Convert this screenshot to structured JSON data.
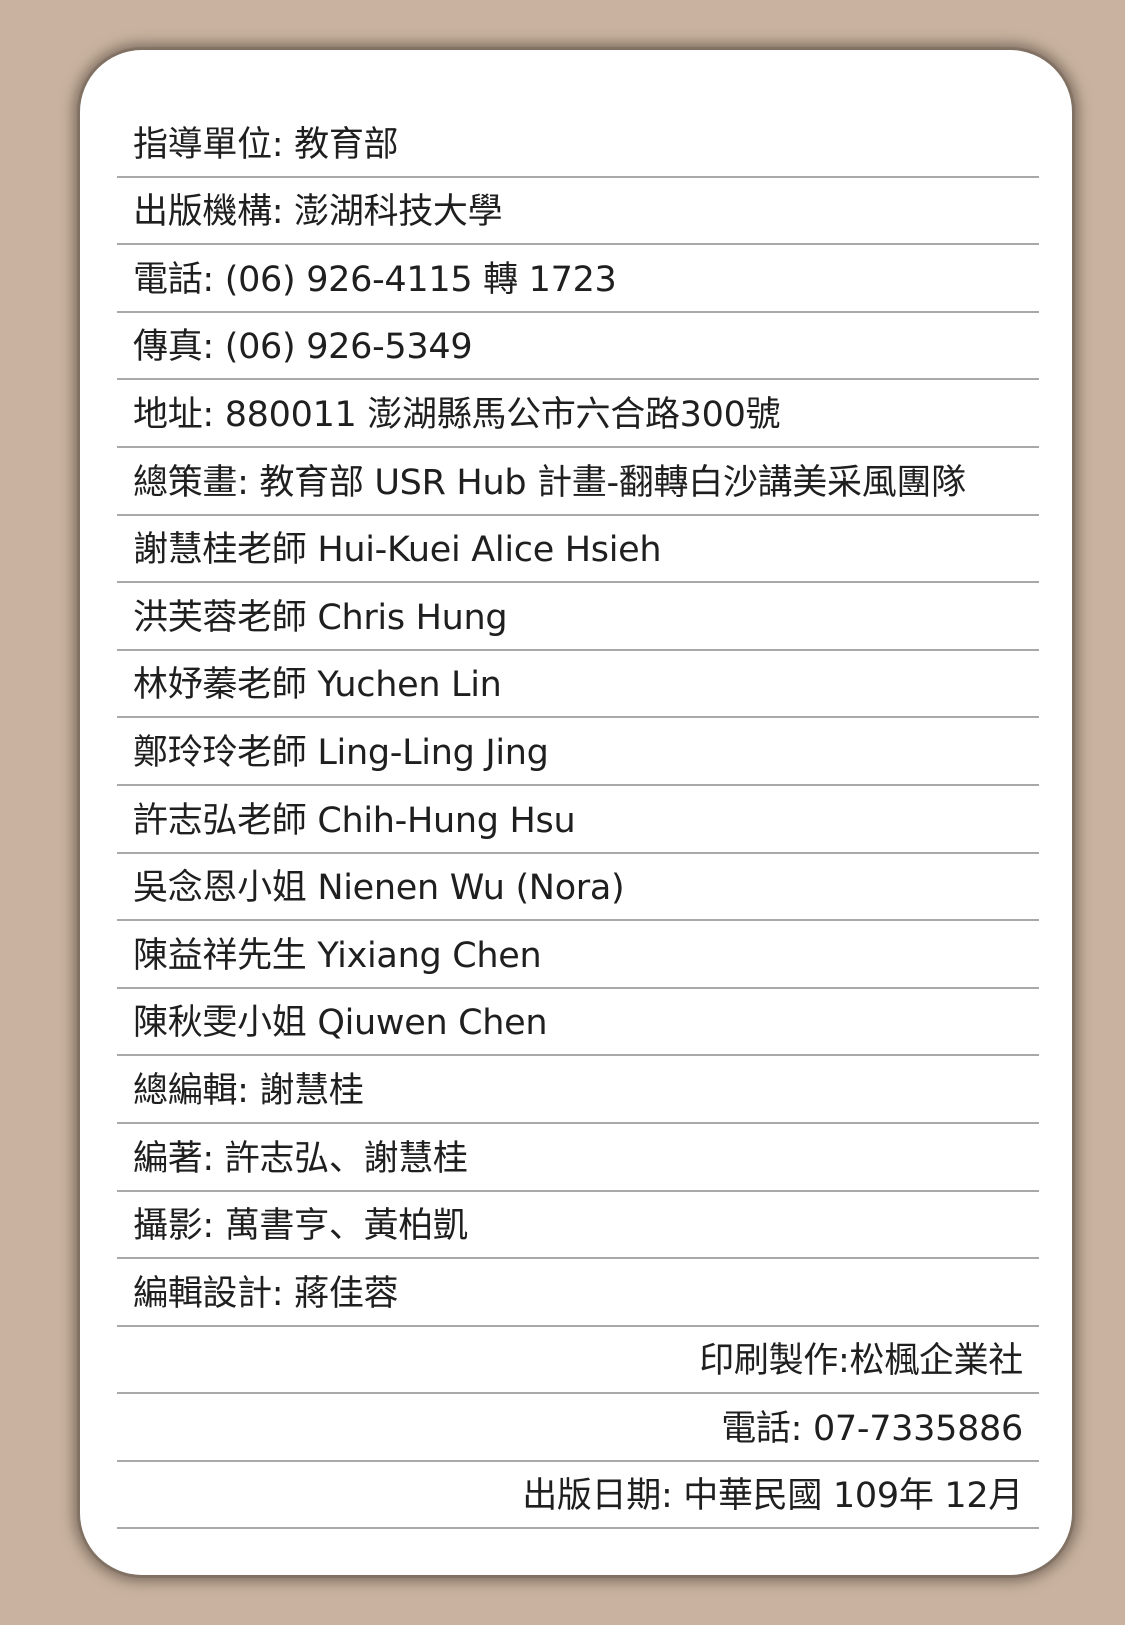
{
  "credits": {
    "rows": [
      {
        "text": "指導單位: 教育部",
        "align": "left"
      },
      {
        "text": "出版機構: 澎湖科技大學",
        "align": "left"
      },
      {
        "text": "電話: (06) 926-4115 轉 1723",
        "align": "left"
      },
      {
        "text": "傳真: (06) 926-5349",
        "align": "left"
      },
      {
        "text": "地址: 880011 澎湖縣馬公市六合路300號",
        "align": "left"
      },
      {
        "text": "總策畫: 教育部 USR Hub 計畫-翻轉白沙講美采風團隊",
        "align": "left"
      },
      {
        "text": "謝慧桂老師 Hui-Kuei Alice Hsieh",
        "align": "left"
      },
      {
        "text": "洪芙蓉老師 Chris Hung",
        "align": "left"
      },
      {
        "text": "林妤蓁老師 Yuchen Lin",
        "align": "left"
      },
      {
        "text": "鄭玲玲老師 Ling-Ling Jing",
        "align": "left"
      },
      {
        "text": "許志弘老師 Chih-Hung Hsu",
        "align": "left"
      },
      {
        "text": "吳念恩小姐 Nienen Wu (Nora)",
        "align": "left"
      },
      {
        "text": "陳益祥先生 Yixiang Chen",
        "align": "left"
      },
      {
        "text": "陳秋雯小姐 Qiuwen Chen",
        "align": "left"
      },
      {
        "text": "總編輯: 謝慧桂",
        "align": "left"
      },
      {
        "text": "編著: 許志弘、謝慧桂",
        "align": "left"
      },
      {
        "text": "攝影: 萬書亨、黃柏凱",
        "align": "left"
      },
      {
        "text": "編輯設計: 蔣佳蓉",
        "align": "left"
      },
      {
        "text": "印刷製作:松楓企業社",
        "align": "right"
      },
      {
        "text": "電話: 07-7335886",
        "align": "right"
      },
      {
        "text": "出版日期: 中華民國 109年 12月",
        "align": "right"
      }
    ]
  },
  "colors": {
    "background": "#c9b3a0",
    "card": "#ffffff",
    "divider": "#a9a9a9",
    "text": "#1f1f1f"
  }
}
